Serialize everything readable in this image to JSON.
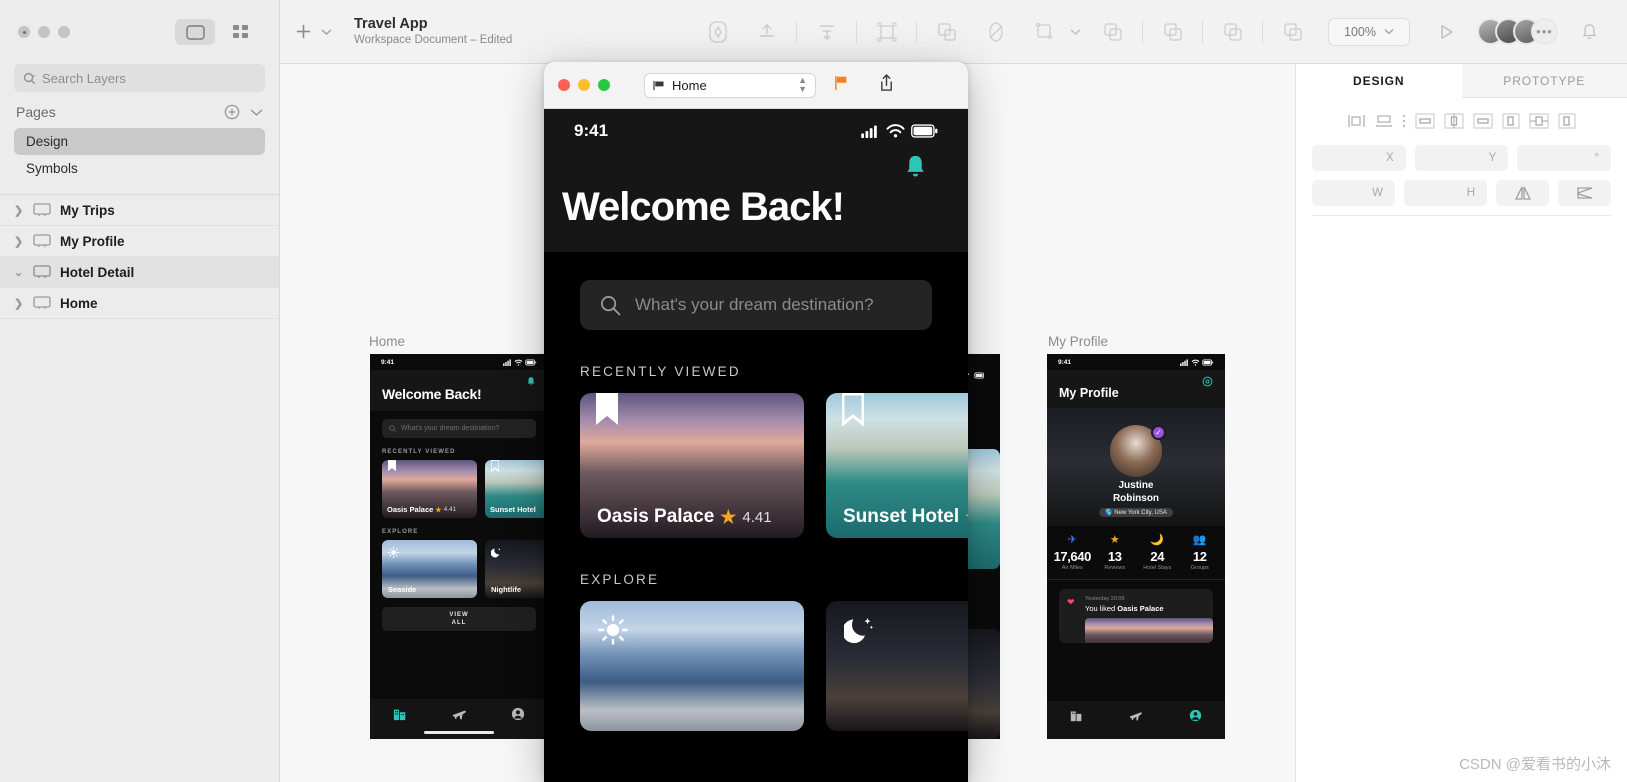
{
  "app": {
    "window_controls": [
      "close",
      "minimize",
      "zoom"
    ],
    "view_toggle": {
      "canvas_label": "canvas-view",
      "grid_label": "grid-view"
    }
  },
  "sidebar": {
    "search": {
      "placeholder": "Search Layers",
      "icon": "search-icon"
    },
    "pages_header": {
      "label": "Pages",
      "add_icon": "plus-circle-icon",
      "collapse_icon": "chevron-down-icon"
    },
    "pages": [
      {
        "label": "Design",
        "selected": true
      },
      {
        "label": "Symbols",
        "selected": false
      }
    ],
    "layers": [
      {
        "label": "My Trips",
        "expanded": false,
        "selected": false,
        "icon": "artboard-icon"
      },
      {
        "label": "My Profile",
        "expanded": false,
        "selected": false,
        "icon": "artboard-icon"
      },
      {
        "label": "Hotel Detail",
        "expanded": true,
        "selected": true,
        "icon": "artboard-icon"
      },
      {
        "label": "Home",
        "expanded": false,
        "selected": false,
        "icon": "artboard-icon"
      }
    ]
  },
  "toolbar": {
    "insert_icon": "plus-icon",
    "insert_chevron": "chevron-down-icon",
    "document_title": "Travel App",
    "document_subtitle": "Workspace Document – Edited",
    "tools": [
      "vector-icon",
      "align-top-icon",
      "distribute-icon",
      "group-icon",
      "mask-icon",
      "rotate-copy-icon",
      "scale-icon",
      "union-icon",
      "subtract-icon",
      "intersect-icon",
      "difference-icon"
    ],
    "zoom_level": "100%",
    "zoom_chevron": "chevron-down-icon",
    "play_icon": "play-icon",
    "avatars_overflow": "•••",
    "notifications_icon": "bell-icon"
  },
  "canvas": {
    "artboards": [
      {
        "name": "Home"
      },
      {
        "name": "My Profile"
      }
    ]
  },
  "home_artboard": {
    "status_time": "9:41",
    "bell_icon": "bell-icon",
    "title": "Welcome Back!",
    "search_placeholder": "What's your dream destination?",
    "section_recent": "RECENTLY VIEWED",
    "recent_cards": [
      {
        "name": "Oasis Palace",
        "rating": "4.41",
        "bookmark": "bookmark-icon"
      },
      {
        "name": "Sunset Hotel",
        "rating": "",
        "bookmark": "bookmark-icon"
      }
    ],
    "section_explore": "EXPLORE",
    "explore_cards": [
      {
        "name": "Seaside",
        "icon": "sun-icon"
      },
      {
        "name": "Nightlife",
        "icon": "moon-icon"
      }
    ],
    "view_all_line1": "VIEW",
    "view_all_line2": "ALL",
    "tabs": [
      "hotels-icon",
      "flights-icon",
      "profile-icon"
    ]
  },
  "profile_artboard": {
    "status_time": "9:41",
    "gear_icon": "gear-icon",
    "title": "My Profile",
    "user_name_line1": "Justine",
    "user_name_line2": "Robinson",
    "verified_icon": "verified-check-icon",
    "location": "New York City, USA",
    "location_icon": "globe-icon",
    "stats": [
      {
        "icon": "airplane-icon",
        "value": "17,640",
        "label": "Air Miles"
      },
      {
        "icon": "star-icon",
        "value": "13",
        "label": "Reviews"
      },
      {
        "icon": "moon-icon",
        "value": "24",
        "label": "Hotel Stays"
      },
      {
        "icon": "group-icon",
        "value": "12",
        "label": "Groups"
      }
    ],
    "activity": {
      "timestamp": "Yesterday 20:05",
      "text_prefix": "You liked ",
      "text_target": "Oasis Palace",
      "heart_icon": "heart-icon"
    },
    "tabs": [
      "hotels-icon",
      "flights-icon",
      "profile-icon"
    ]
  },
  "preview": {
    "window_dots": [
      "#ff5f57",
      "#febc2e",
      "#28c840"
    ],
    "selected_artboard": "Home",
    "artboard_icon": "artboard-small-icon",
    "stepper_icon": "stepper-updown-icon",
    "flag_icon": "flag-icon",
    "flag_color": "#f58220",
    "share_icon": "share-icon",
    "status_time": "9:41",
    "signal_icon": "signal-icon",
    "wifi_icon": "wifi-icon",
    "battery_icon": "battery-icon",
    "bell_icon": "bell-icon",
    "bell_color": "#2ec4b6",
    "title": "Welcome Back!",
    "search_placeholder": "What's your dream destination?",
    "search_icon": "search-icon",
    "section_recent": "RECENTLY VIEWED",
    "cards": [
      {
        "name": "Oasis Palace",
        "rating": "4.41",
        "star_icon": "star-icon",
        "bookmark_icon": "bookmark-icon"
      },
      {
        "name": "Sunset Hotel",
        "rating": "",
        "star_icon": "star-icon",
        "bookmark_icon": "bookmark-icon"
      }
    ],
    "section_explore": "EXPLORE",
    "explore": [
      {
        "icon": "sun-icon"
      },
      {
        "icon": "moon-stars-icon"
      }
    ]
  },
  "right_panel": {
    "tabs": [
      {
        "label": "DESIGN",
        "active": true
      },
      {
        "label": "PROTOTYPE",
        "active": false
      }
    ],
    "align_icons": [
      "align-left-icon",
      "align-center-h-icon",
      "more-align-icon",
      "align-hcenter-box-icon",
      "align-middle-icon",
      "align-right-box-icon",
      "dist-left-icon",
      "dist-center-icon",
      "dist-right-icon"
    ],
    "fields": {
      "x_label": "X",
      "y_label": "Y",
      "rotation_label": "°",
      "w_label": "W",
      "h_label": "H",
      "flip_h_icon": "flip-horizontal-icon",
      "flip_v_icon": "flip-vertical-icon"
    }
  },
  "watermark": "CSDN @爱看书的小沐",
  "colors": {
    "accent_teal": "#2ec4b6",
    "accent_orange": "#f5a623",
    "accent_purple": "#9b51e0",
    "accent_blue": "#2f80ed",
    "accent_pink": "#ff4d6d",
    "sidebar_bg": "#ececec",
    "canvas_bg": "#f7f7f7"
  }
}
